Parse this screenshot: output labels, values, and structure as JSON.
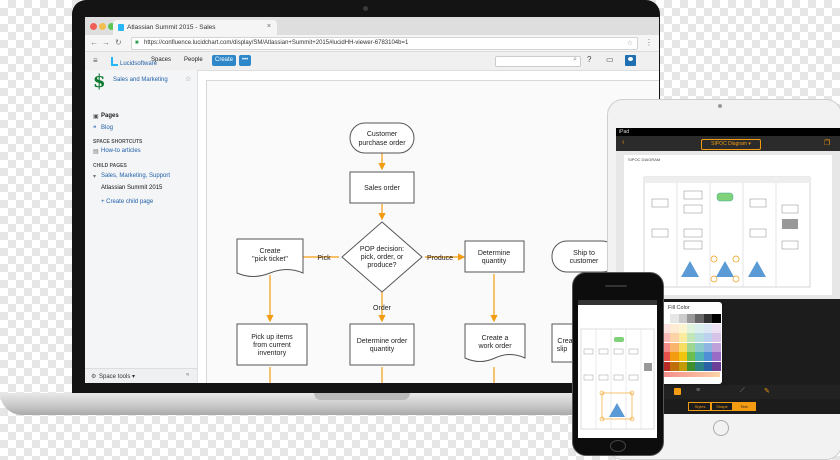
{
  "browser": {
    "tab_title": "Atlassian Summit 2015 - Sales",
    "url": "https://confluence.lucidchart.com/display/SM/Atlassian+Summit+2015#lucidHH-viewer-6783104b=1"
  },
  "header": {
    "logo": "Lucidsoftware",
    "spaces": "Spaces",
    "people": "People",
    "create": "Create",
    "more": "•••"
  },
  "sidebar": {
    "space_name": "Sales and Marketing",
    "pages": "Pages",
    "blog": "Blog",
    "shortcuts_header": "SPACE SHORTCUTS",
    "howto": "How-to articles",
    "child_header": "CHILD PAGES",
    "child_item": "Sales, Marketing, Support",
    "current_item": "Atlassian Summit 2015",
    "create_child": "+ Create child page",
    "space_tools": "Space tools ▾",
    "collapse": "«"
  },
  "flowchart": {
    "customer_order_1": "Customer",
    "customer_order_2": "purchase order",
    "sales_order": "Sales order",
    "pop_1": "POP decision:",
    "pop_2": "pick, order, or",
    "pop_3": "produce?",
    "pick_label": "Pick",
    "produce_label": "Produce",
    "order_label": "Order",
    "create_ticket_1": "Create",
    "create_ticket_2": "\"pick ticket\"",
    "determine_qty_1": "Determine",
    "determine_qty_2": "quantity",
    "ship_1": "Ship to",
    "ship_2": "customer",
    "pickup_1": "Pick up items",
    "pickup_2": "from current",
    "pickup_3": "inventory",
    "det_order_1": "Determine order",
    "det_order_2": "quantity",
    "work_order_1": "Create a",
    "work_order_2": "work order",
    "slip_1": "Crea",
    "slip_2": "slip"
  },
  "tablet": {
    "doc_title": "SIPOC Diagram ▾",
    "sheet_title": "SIPOC DIAGRAM",
    "status_left": "iPad",
    "tool_labels": [
      "Styles",
      "Shape",
      "Text"
    ]
  },
  "color_panel": {
    "title": "Fill Color",
    "swatches": [
      [
        "#ffffff",
        "#e6e6e6",
        "#cccccc",
        "#999999",
        "#666666",
        "#333333",
        "#000000"
      ],
      [
        "#fde2e2",
        "#fdebd3",
        "#fdf5cf",
        "#e0f3dc",
        "#dcefef",
        "#dde8f6",
        "#ebe1f3"
      ],
      [
        "#f9b9b9",
        "#fcd3a6",
        "#fbeb9e",
        "#c2e6b9",
        "#b9dfe0",
        "#bbd1ee",
        "#d7c3e7"
      ],
      [
        "#f48a8a",
        "#f9b56b",
        "#f7dd62",
        "#9fd690",
        "#8ecbcc",
        "#8fb5e3",
        "#bfa0d8"
      ],
      [
        "#e8504c",
        "#f39c12",
        "#f1c40f",
        "#6cbf4f",
        "#4fb3b6",
        "#4f8fd6",
        "#9b6cc6"
      ],
      [
        "#b92b27",
        "#c0700a",
        "#c29b0b",
        "#3f8f2c",
        "#2b8285",
        "#2b62a6",
        "#6d3f96"
      ]
    ]
  },
  "colors": {
    "connector": "#f39c12",
    "accent": "#2d87c8"
  }
}
